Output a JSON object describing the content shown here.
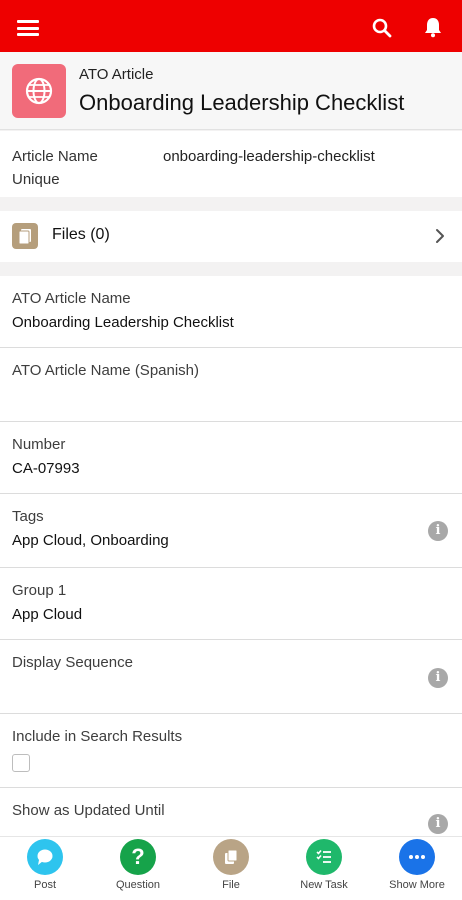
{
  "app": {
    "menu_icon": "hamburger-icon",
    "search_icon": "search-icon",
    "notifications_icon": "bell-icon",
    "brand_color": "#ee0000"
  },
  "header": {
    "object_type": "ATO Article",
    "title": "Onboarding Leadership Checklist",
    "icon": "globe-icon",
    "icon_color": "#f16b7a"
  },
  "unique": {
    "label": "Article Name Unique",
    "value": "onboarding-leadership-checklist"
  },
  "files": {
    "label": "Files (0)",
    "icon": "files-icon"
  },
  "fields": [
    {
      "label": "ATO Article Name",
      "value": "Onboarding Leadership Checklist",
      "info": false
    },
    {
      "label": "ATO Article Name (Spanish)",
      "value": "",
      "info": false
    },
    {
      "label": "Number",
      "value": "CA-07993",
      "info": false
    },
    {
      "label": "Tags",
      "value": "App Cloud, Onboarding",
      "info": true
    },
    {
      "label": "Group 1",
      "value": "App Cloud",
      "info": false
    },
    {
      "label": "Display Sequence",
      "value": "",
      "info": true
    },
    {
      "label": "Include in Search Results",
      "checkbox": false,
      "info": false
    },
    {
      "label": "Show as Updated Until",
      "value": "",
      "info": true
    }
  ],
  "actions": [
    {
      "label": "Post",
      "icon": "chat-bubble-icon",
      "color": "#2ec4ee"
    },
    {
      "label": "Question",
      "icon": "question-mark-icon",
      "color": "#16a34a"
    },
    {
      "label": "File",
      "icon": "file-upload-icon",
      "color": "#b9a486"
    },
    {
      "label": "New Task",
      "icon": "task-list-icon",
      "color": "#1fb86b"
    },
    {
      "label": "Show More",
      "icon": "ellipsis-icon",
      "color": "#1a73e8"
    }
  ]
}
